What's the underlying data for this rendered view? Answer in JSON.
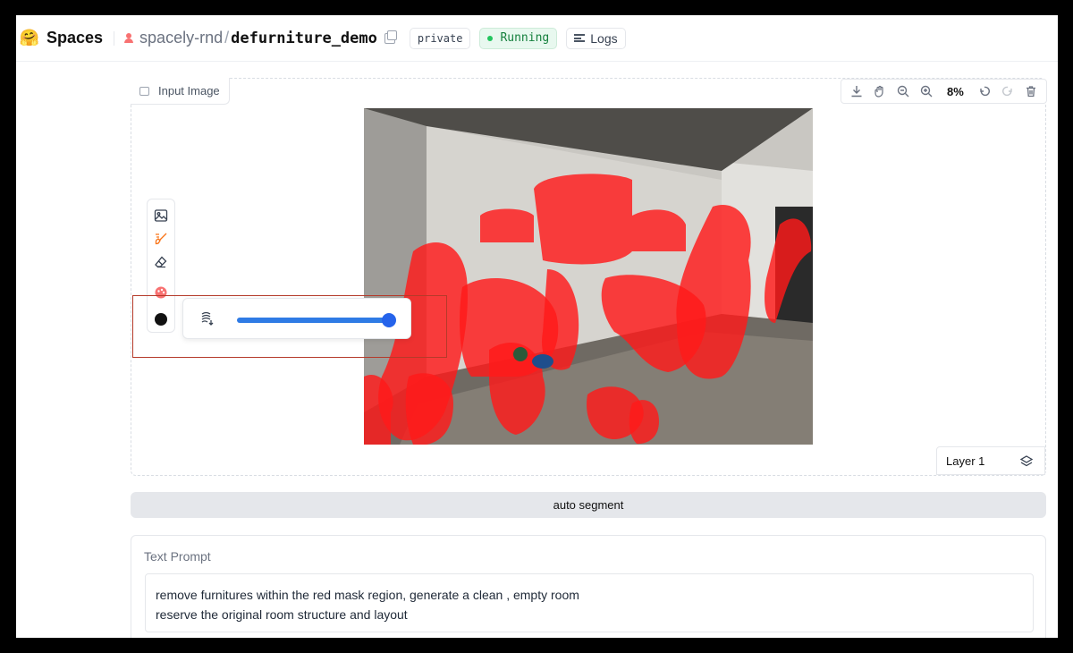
{
  "header": {
    "logo_icon": "hugging-face-emoji",
    "brand": "Spaces",
    "owner": "spacely-rnd",
    "separator": "/",
    "repo": "defurniture_demo",
    "visibility_badge": "private",
    "status": "Running",
    "status_color": "#15803d",
    "logs_label": "Logs"
  },
  "image_editor": {
    "label": "Input Image",
    "zoom": "8%",
    "toolbar_icons": [
      "download-icon",
      "pan-hand-icon",
      "zoom-out-icon",
      "zoom-in-icon",
      "undo-icon",
      "redo-icon",
      "trash-icon"
    ],
    "tools": [
      "image-icon",
      "brush-icon",
      "eraser-icon",
      "color-palette-icon",
      "color-swatch-icon"
    ],
    "brush_size_fraction": 1.0,
    "brush_color": "#111111",
    "mask_color": "#ff1a1a",
    "layer_label": "Layer 1"
  },
  "auto_segment_label": "auto segment",
  "text_prompt": {
    "label": "Text Prompt",
    "value": "remove furnitures within the red mask region, generate a clean , empty room\nreserve the original room structure and layout"
  }
}
